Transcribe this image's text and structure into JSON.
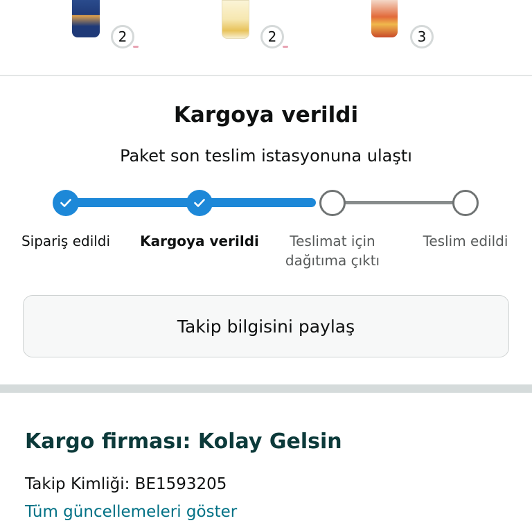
{
  "products": [
    {
      "name": "product-1",
      "quantity": "2",
      "colors": [
        "#1f3a78",
        "#e2a24a"
      ]
    },
    {
      "name": "product-2",
      "quantity": "2",
      "colors": [
        "#f6e7b0",
        "#e8c25a"
      ]
    },
    {
      "name": "product-3",
      "quantity": "3",
      "colors": [
        "#e26a3a",
        "#f0b84c"
      ]
    }
  ],
  "shipment": {
    "title": "Kargoya verildi",
    "subtitle": "Paket son teslim istasyonuna ulaştı",
    "steps": [
      {
        "label": "Sipariş edildi",
        "status": "done"
      },
      {
        "label": "Kargoya verildi",
        "status": "current"
      },
      {
        "label": "Teslimat için dağıtıma çıktı",
        "status": "todo"
      },
      {
        "label": "Teslim edildi",
        "status": "todo"
      }
    ],
    "share_label": "Takip bilgisini paylaş"
  },
  "carrier": {
    "title": "Kargo firması: Kolay Gelsin",
    "tracking_id": "Takip Kimliği: BE1593205",
    "all_updates_link": "Tüm güncellemeleri göster"
  },
  "colors": {
    "accent": "#1d88d8",
    "link": "#007185",
    "carrier_title": "#0c3a3a"
  }
}
